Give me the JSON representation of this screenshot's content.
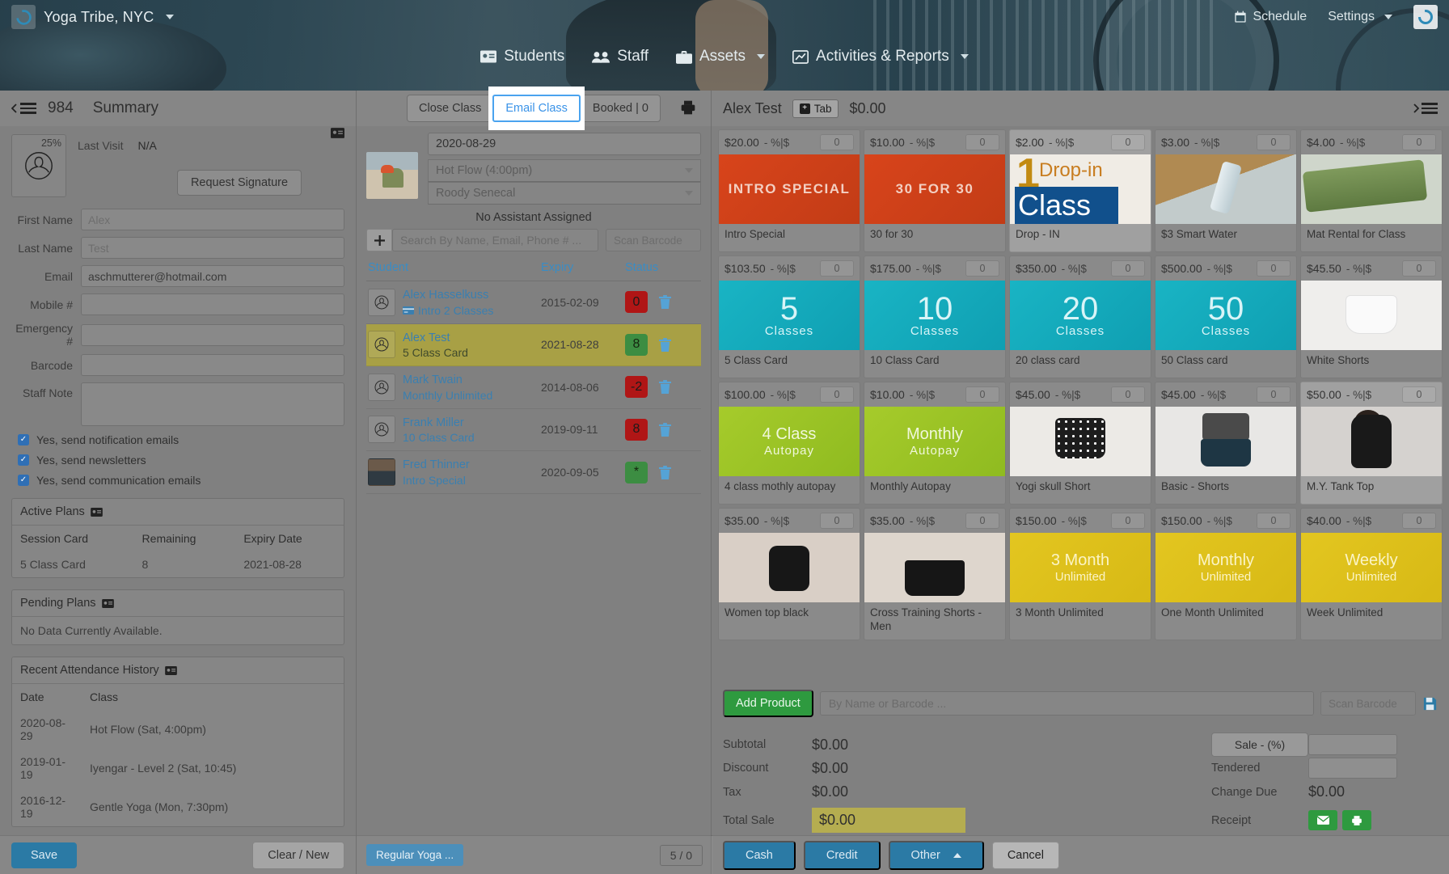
{
  "topbar": {
    "brand": "Yoga Tribe, NYC",
    "brand_logo_icon": "circle-swirl-logo-icon",
    "brand_caret_icon": "caret-down-icon",
    "schedule": "Schedule",
    "schedule_icon": "calendar-icon",
    "settings": "Settings",
    "settings_caret_icon": "caret-down-icon",
    "account_logo_icon": "circle-swirl-logo-icon"
  },
  "mainnav": {
    "items": [
      {
        "label": "Students",
        "icon": "id-card-icon",
        "caret": false
      },
      {
        "label": "Staff",
        "icon": "users-icon",
        "caret": false
      },
      {
        "label": "Assets",
        "icon": "briefcase-icon",
        "caret": true
      },
      {
        "label": "Activities & Reports",
        "icon": "chart-line-icon",
        "caret": true
      }
    ]
  },
  "left": {
    "menu_icon": "collapse-menu-icon",
    "record_id": "984",
    "title": "Summary",
    "avatar_pct": "25%",
    "avatar_icon": "person-silhouette-icon",
    "card_icon": "id-card-icon",
    "last_visit_label": "Last Visit",
    "last_visit_value": "N/A",
    "request_signature": "Request Signature",
    "fields": [
      {
        "label": "First Name",
        "value": "",
        "placeholder": "Alex"
      },
      {
        "label": "Last Name",
        "value": "",
        "placeholder": "Test"
      },
      {
        "label": "Email",
        "value": "aschmutterer@hotmail.com",
        "placeholder": ""
      },
      {
        "label": "Mobile #",
        "value": "",
        "placeholder": ""
      },
      {
        "label": "Emergency #",
        "value": "",
        "placeholder": ""
      },
      {
        "label": "Barcode",
        "value": "",
        "placeholder": ""
      }
    ],
    "staff_note_label": "Staff Note",
    "checkboxes": [
      {
        "label": "Yes, send notification emails",
        "checked": true
      },
      {
        "label": "Yes, send newsletters",
        "checked": true
      },
      {
        "label": "Yes, send communication emails",
        "checked": true
      }
    ],
    "active_plans": {
      "title": "Active Plans",
      "icon": "id-card-icon",
      "headers": [
        "Session Card",
        "Remaining",
        "Expiry Date"
      ],
      "rows": [
        [
          "5 Class Card",
          "8",
          "2021-08-28"
        ]
      ]
    },
    "pending_plans": {
      "title": "Pending Plans",
      "icon": "id-card-icon",
      "empty": "No Data Currently Available."
    },
    "attendance": {
      "title": "Recent Attendance History",
      "icon": "id-card-icon",
      "headers": [
        "Date",
        "Class"
      ],
      "rows": [
        [
          "2020-08-29",
          "Hot Flow (Sat, 4:00pm)"
        ],
        [
          "2019-01-19",
          "Iyengar - Level 2 (Sat, 10:45)"
        ],
        [
          "2016-12-19",
          "Gentle Yoga (Mon, 7:30pm)"
        ]
      ]
    },
    "save_label": "Save",
    "clear_label": "Clear / New"
  },
  "center": {
    "buttons": [
      {
        "label": "Close Class",
        "focused": false
      },
      {
        "label": "Email Class",
        "focused": true
      },
      {
        "label": "Booked | 0",
        "focused": false
      }
    ],
    "print_icon": "printer-icon",
    "date": "2020-08-29",
    "class_name": "Hot Flow (4:00pm)",
    "instructor": "Roody Senecal",
    "assistant_note": "No Assistant Assigned",
    "add_icon": "plus-icon",
    "search_placeholder": "Search By Name, Email, Phone # ...",
    "scan_placeholder": "Scan Barcode",
    "table_headers": {
      "student": "Student",
      "expiry": "Expiry",
      "status": "Status"
    },
    "students": [
      {
        "name": "Alex Hasselkuss",
        "plan": "Intro 2 Classes",
        "plan_icon": "card-icon",
        "expiry": "2015-02-09",
        "status": "0",
        "status_color": "red",
        "selected": false,
        "avatar": "person-silhouette-icon",
        "delete_icon": "trash-icon"
      },
      {
        "name": "Alex Test",
        "plan": "5 Class Card",
        "plan_icon": "",
        "expiry": "2021-08-28",
        "status": "8",
        "status_color": "green",
        "selected": true,
        "avatar": "person-silhouette-icon",
        "delete_icon": "trash-icon"
      },
      {
        "name": "Mark Twain",
        "plan": "Monthly Unlimited",
        "plan_icon": "",
        "expiry": "2014-08-06",
        "status": "-2",
        "status_color": "red",
        "selected": false,
        "avatar": "person-silhouette-icon",
        "delete_icon": "trash-icon"
      },
      {
        "name": "Frank Miller",
        "plan": "10 Class Card",
        "plan_icon": "",
        "expiry": "2019-09-11",
        "status": "8",
        "status_color": "red",
        "selected": false,
        "avatar": "person-silhouette-icon",
        "delete_icon": "trash-icon"
      },
      {
        "name": "Fred Thinner",
        "plan": "Intro Special",
        "plan_icon": "",
        "expiry": "2020-09-05",
        "status": "*",
        "status_color": "green",
        "selected": false,
        "avatar": "photo-avatar",
        "delete_icon": "trash-icon"
      }
    ],
    "footer_tag": "Regular Yoga ...",
    "footer_count": "5 / 0"
  },
  "right": {
    "customer": "Alex Test",
    "tab_label": "Tab",
    "tab_icon": "plus-square-icon",
    "tab_total": "$0.00",
    "collapse_icon": "collapse-menu-right-icon",
    "pct_label": "- %|$",
    "products": [
      {
        "price": "$20.00",
        "qty": "0",
        "name": "Intro Special",
        "art": "t-orange",
        "art_text": "INTRO SPECIAL",
        "highlight": false
      },
      {
        "price": "$10.00",
        "qty": "0",
        "name": "30 for 30",
        "art": "t-orange",
        "art_text": "30 FOR 30",
        "highlight": false
      },
      {
        "price": "$2.00",
        "qty": "0",
        "name": "Drop - IN",
        "art": "t-dropin",
        "art_text": "1 Drop-in Class",
        "highlight": true
      },
      {
        "price": "$3.00",
        "qty": "0",
        "name": "$3 Smart Water",
        "art": "t-water",
        "art_text": "",
        "highlight": false
      },
      {
        "price": "$4.00",
        "qty": "0",
        "name": "Mat Rental for Class",
        "art": "t-mat",
        "art_text": "",
        "highlight": false
      },
      {
        "price": "$103.50",
        "qty": "0",
        "name": "5 Class Card",
        "art": "t-teal",
        "art_num": "5",
        "art_sub": "Classes",
        "highlight": false
      },
      {
        "price": "$175.00",
        "qty": "0",
        "name": "10 Class Card",
        "art": "t-teal",
        "art_num": "10",
        "art_sub": "Classes",
        "highlight": false
      },
      {
        "price": "$350.00",
        "qty": "0",
        "name": "20 class card",
        "art": "t-teal",
        "art_num": "20",
        "art_sub": "Classes",
        "highlight": false
      },
      {
        "price": "$500.00",
        "qty": "0",
        "name": "50 Class card",
        "art": "t-teal",
        "art_num": "50",
        "art_sub": "Classes",
        "highlight": false
      },
      {
        "price": "$45.50",
        "qty": "0",
        "name": "White Shorts",
        "art": "t-white",
        "highlight": false
      },
      {
        "price": "$100.00",
        "qty": "0",
        "name": "4 class mothly autopay",
        "art": "t-lime",
        "art_l1": "4 Class",
        "art_l2": "Autopay",
        "highlight": false
      },
      {
        "price": "$10.00",
        "qty": "0",
        "name": "Monthly Autopay",
        "art": "t-lime",
        "art_l1": "Monthly",
        "art_l2": "Autopay",
        "highlight": false
      },
      {
        "price": "$45.00",
        "qty": "0",
        "name": "Yogi skull Short",
        "art": "t-shorts1",
        "highlight": false
      },
      {
        "price": "$45.00",
        "qty": "0",
        "name": "Basic - Shorts",
        "art": "t-shorts2",
        "highlight": false
      },
      {
        "price": "$50.00",
        "qty": "0",
        "name": "M.Y. Tank Top",
        "art": "t-tank",
        "highlight": true
      },
      {
        "price": "$35.00",
        "qty": "0",
        "name": "Women top black",
        "art": "t-wtop",
        "highlight": false
      },
      {
        "price": "$35.00",
        "qty": "0",
        "name": "Cross Training Shorts - Men",
        "art": "t-cross",
        "highlight": false
      },
      {
        "price": "$150.00",
        "qty": "0",
        "name": "3 Month Unlimited",
        "art": "t-gold",
        "art_l1": "3 Month",
        "art_l2": "Unlimited",
        "highlight": false
      },
      {
        "price": "$150.00",
        "qty": "0",
        "name": "One Month Unlimited",
        "art": "t-gold",
        "art_l1": "Monthly",
        "art_l2": "Unlimited",
        "highlight": false
      },
      {
        "price": "$40.00",
        "qty": "0",
        "name": "Week Unlimited",
        "art": "t-gold",
        "art_l1": "Weekly",
        "art_l2": "Unlimited",
        "highlight": false
      }
    ],
    "add_product_label": "Add Product",
    "add_product_placeholder": "By Name or Barcode ...",
    "scan_placeholder": "Scan Barcode",
    "save_icon": "save-disk-icon",
    "totals": [
      {
        "label": "Subtotal",
        "value": "$0.00",
        "label2": "",
        "value2": "",
        "highlight": false
      },
      {
        "label": "Discount",
        "value": "$0.00",
        "label2": "Tendered",
        "value2": "",
        "highlight": false
      },
      {
        "label": "Tax",
        "value": "$0.00",
        "label2": "Change Due",
        "value2": "$0.00",
        "highlight": false
      },
      {
        "label": "Total Sale",
        "value": "$0.00",
        "label2": "Receipt",
        "value2": "",
        "highlight": true
      }
    ],
    "sale_pct_label": "Sale - (%)",
    "receipt_email_icon": "envelope-icon",
    "receipt_print_icon": "printer-icon",
    "pay_buttons": [
      {
        "label": "Cash",
        "kind": "primary"
      },
      {
        "label": "Credit",
        "kind": "primary"
      },
      {
        "label": "Other",
        "kind": "primary-caret"
      },
      {
        "label": "Cancel",
        "kind": "plain"
      }
    ]
  }
}
